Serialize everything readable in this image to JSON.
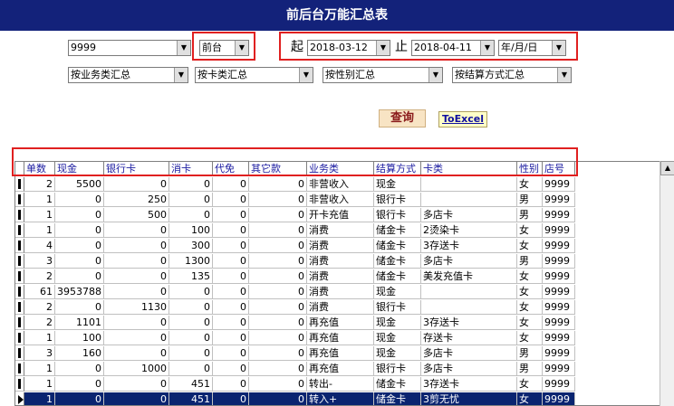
{
  "title": "前后台万能汇总表",
  "filters": {
    "store_value": "9999",
    "frontback_value": "前台",
    "start_label": "起",
    "start_date": "2018-03-12",
    "end_label": "止",
    "end_date": "2018-04-11",
    "granularity_value": "年/月/日",
    "group1_value": "按业务类汇总",
    "group2_value": "按卡类汇总",
    "group3_value": "按性别汇总",
    "group4_value": "按结算方式汇总"
  },
  "actions": {
    "query_label": "查询",
    "excel_label": "ToExcel"
  },
  "table": {
    "columns": [
      "单数",
      "现金",
      "银行卡",
      "消卡",
      "代免",
      "其它款",
      "业务类",
      "结算方式",
      "卡类",
      "性别",
      "店号"
    ],
    "rows": [
      [
        "2",
        "5500",
        "0",
        "0",
        "0",
        "0",
        "非营收入",
        "现金",
        "",
        "女",
        "9999"
      ],
      [
        "1",
        "0",
        "250",
        "0",
        "0",
        "0",
        "非营收入",
        "银行卡",
        "",
        "男",
        "9999"
      ],
      [
        "1",
        "0",
        "500",
        "0",
        "0",
        "0",
        "开卡充值",
        "银行卡",
        "多店卡",
        "男",
        "9999"
      ],
      [
        "1",
        "0",
        "0",
        "100",
        "0",
        "0",
        "消费",
        "储金卡",
        "2烫染卡",
        "女",
        "9999"
      ],
      [
        "4",
        "0",
        "0",
        "300",
        "0",
        "0",
        "消费",
        "储金卡",
        "3存送卡",
        "女",
        "9999"
      ],
      [
        "3",
        "0",
        "0",
        "1300",
        "0",
        "0",
        "消费",
        "储金卡",
        "多店卡",
        "男",
        "9999"
      ],
      [
        "2",
        "0",
        "0",
        "135",
        "0",
        "0",
        "消费",
        "储金卡",
        "美发充值卡",
        "女",
        "9999"
      ],
      [
        "61",
        "3953788",
        "0",
        "0",
        "0",
        "0",
        "消费",
        "现金",
        "",
        "女",
        "9999"
      ],
      [
        "2",
        "0",
        "1130",
        "0",
        "0",
        "0",
        "消费",
        "银行卡",
        "",
        "女",
        "9999"
      ],
      [
        "2",
        "1101",
        "0",
        "0",
        "0",
        "0",
        "再充值",
        "现金",
        "3存送卡",
        "女",
        "9999"
      ],
      [
        "1",
        "100",
        "0",
        "0",
        "0",
        "0",
        "再充值",
        "现金",
        "存送卡",
        "女",
        "9999"
      ],
      [
        "3",
        "160",
        "0",
        "0",
        "0",
        "0",
        "再充值",
        "现金",
        "多店卡",
        "男",
        "9999"
      ],
      [
        "1",
        "0",
        "1000",
        "0",
        "0",
        "0",
        "再充值",
        "银行卡",
        "多店卡",
        "男",
        "9999"
      ],
      [
        "1",
        "0",
        "0",
        "451",
        "0",
        "0",
        "转出-",
        "储金卡",
        "3存送卡",
        "女",
        "9999"
      ],
      [
        "1",
        "0",
        "0",
        "451",
        "0",
        "0",
        "转入+",
        "储金卡",
        "3剪无忧",
        "女",
        "9999"
      ]
    ],
    "selected_row_index": 14
  },
  "colors": {
    "titlebar": "#13227a",
    "selected_row": "#0a2470",
    "highlight_box": "#e02020",
    "header_text": "#1a1aa0"
  },
  "icons": {
    "dropdown": "chevron-down-icon",
    "scroll_up": "arrow-up-icon",
    "row_indicator": "record-pointer-icon"
  }
}
